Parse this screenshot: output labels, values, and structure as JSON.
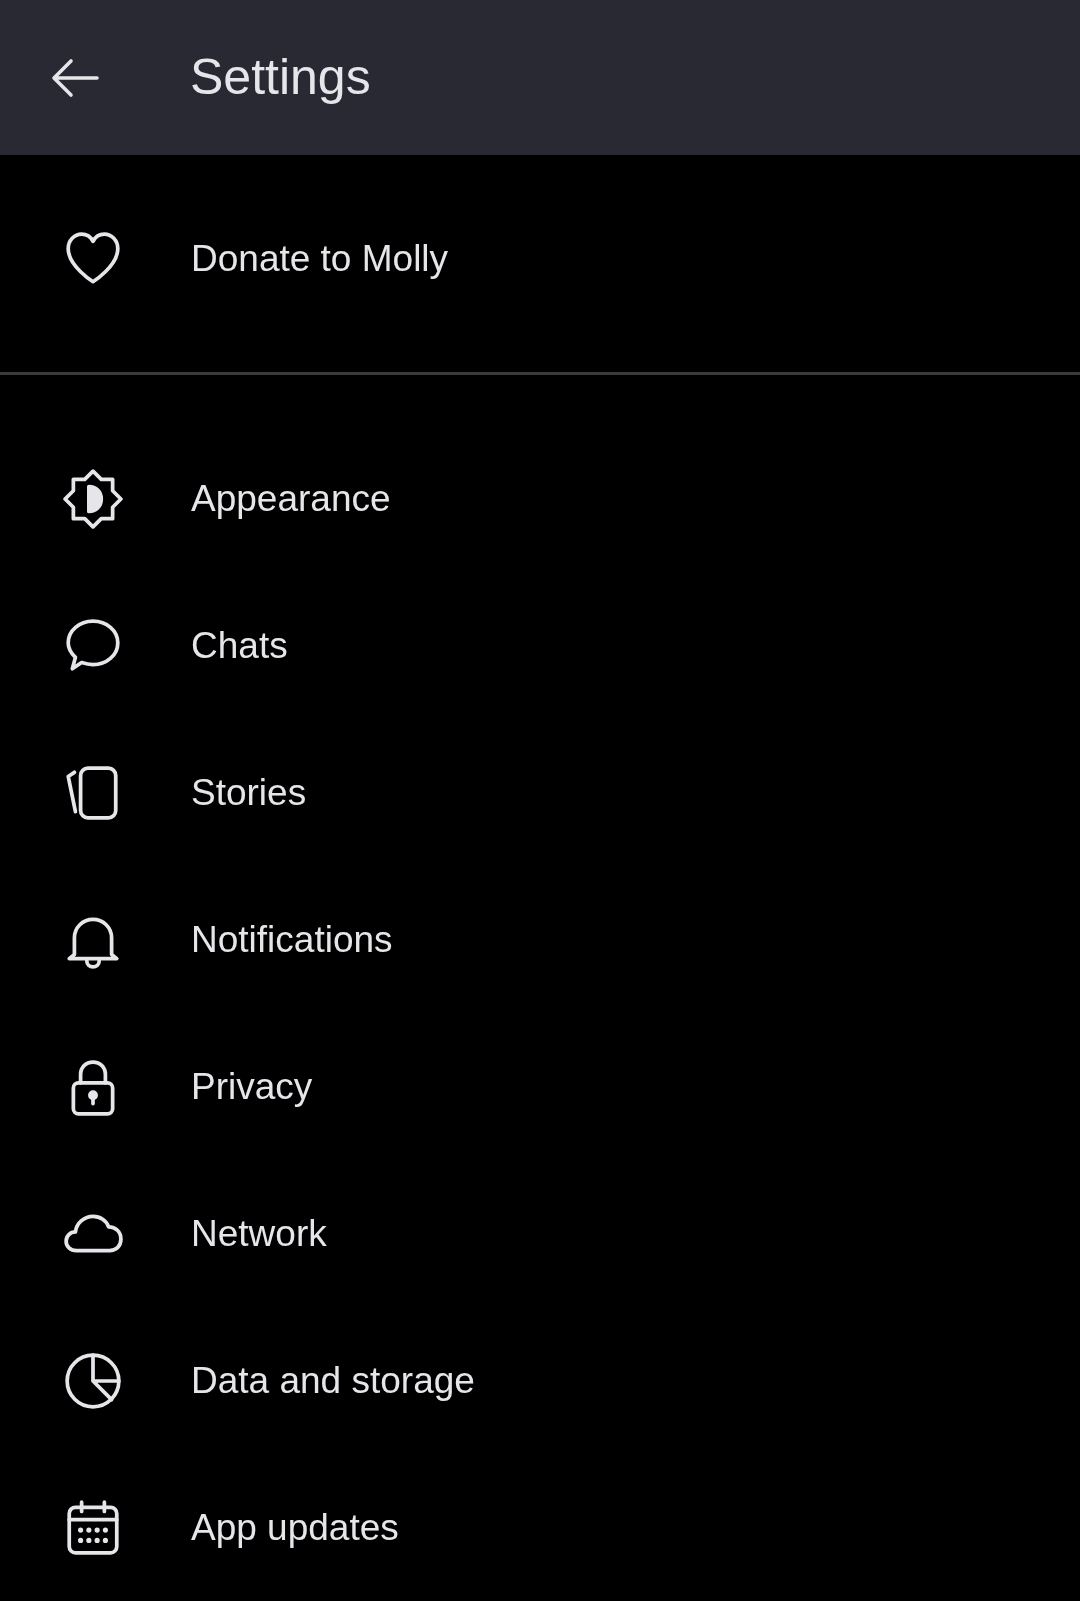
{
  "header": {
    "title": "Settings"
  },
  "sections": [
    {
      "items": [
        {
          "label": "Donate to Molly"
        }
      ]
    },
    {
      "items": [
        {
          "label": "Appearance"
        },
        {
          "label": "Chats"
        },
        {
          "label": "Stories"
        },
        {
          "label": "Notifications"
        },
        {
          "label": "Privacy"
        },
        {
          "label": "Network"
        },
        {
          "label": "Data and storage"
        },
        {
          "label": "App updates"
        }
      ]
    }
  ]
}
